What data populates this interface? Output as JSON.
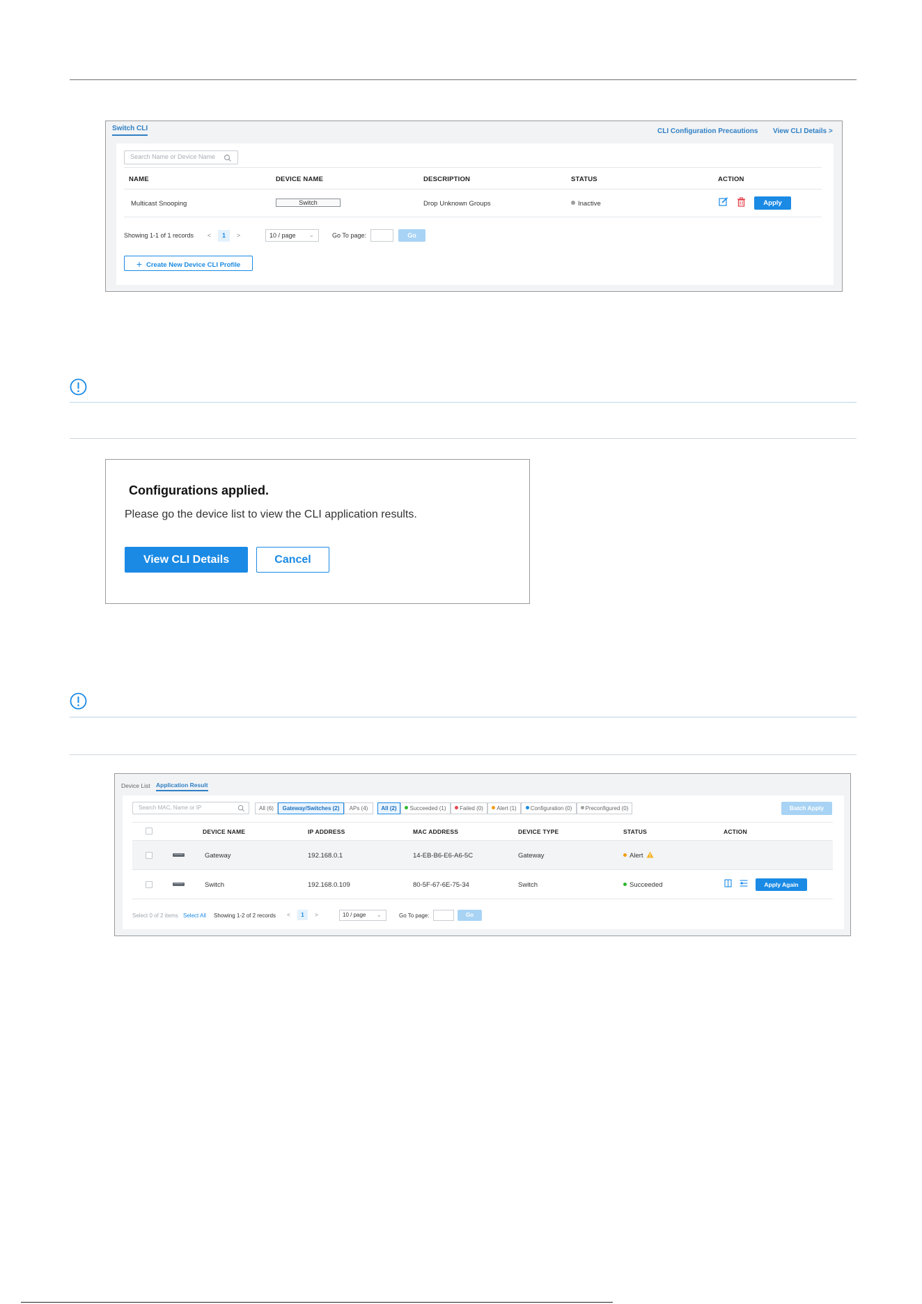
{
  "fig1": {
    "tab": "Switch CLI",
    "links": {
      "precautions": "CLI Configuration Precautions",
      "view_details": "View CLI Details >"
    },
    "search_placeholder": "Search Name or Device Name",
    "columns": [
      "NAME",
      "DEVICE NAME",
      "DESCRIPTION",
      "STATUS",
      "ACTION"
    ],
    "row": {
      "name": "Multicast Snooping",
      "device": "Switch",
      "description": "Drop Unknown Groups",
      "status": "Inactive",
      "apply": "Apply"
    },
    "pagination": {
      "summary": "Showing 1-1 of 1 records",
      "prev": "<",
      "page": "1",
      "next": ">",
      "per_page": "10 / page",
      "goto_label": "Go To page:",
      "go": "Go"
    },
    "create_button": "Create New Device CLI Profile"
  },
  "fig2": {
    "title": "Configurations applied.",
    "message": "Please go the device list to view the CLI application results.",
    "primary_button": "View CLI Details",
    "cancel_button": "Cancel"
  },
  "fig3": {
    "tabs": {
      "device_list": "Device List",
      "application_result": "Application Result"
    },
    "search_placeholder": "Search MAC, Name or IP",
    "type_filters": [
      "All (6)",
      "Gateway/Switches (2)",
      "APs (4)"
    ],
    "status_filters": [
      "All (2)",
      "Succeeded (1)",
      "Failed (0)",
      "Alert (1)",
      "Configuration (0)",
      "Preconfigured (0)"
    ],
    "batch_apply": "Batch Apply",
    "columns": [
      "DEVICE NAME",
      "IP ADDRESS",
      "MAC ADDRESS",
      "DEVICE TYPE",
      "STATUS",
      "ACTION"
    ],
    "rows": [
      {
        "name": "Gateway",
        "ip": "192.168.0.1",
        "mac": "14-EB-B6-E6-A6-5C",
        "type": "Gateway",
        "status": "Alert"
      },
      {
        "name": "Switch",
        "ip": "192.168.0.109",
        "mac": "80-5F-67-6E-75-34",
        "type": "Switch",
        "status": "Succeeded",
        "action": "Apply Again"
      }
    ],
    "footer": {
      "selected": "Select 0 of 2 items",
      "select_all": "Select All",
      "summary": "Showing 1-2 of 2 records",
      "prev": "<",
      "page": "1",
      "next": ">",
      "per_page": "10 / page",
      "goto_label": "Go To page:",
      "go": "Go"
    }
  },
  "colors": {
    "primary": "#1a8ae5",
    "link": "#2f7fc4",
    "inactive": "#9e9e9e",
    "alert": "#f39c12",
    "succeeded": "#2eb82e",
    "failed": "#e5434e",
    "configuration": "#1a8ae5",
    "delete": "#e5434e"
  }
}
